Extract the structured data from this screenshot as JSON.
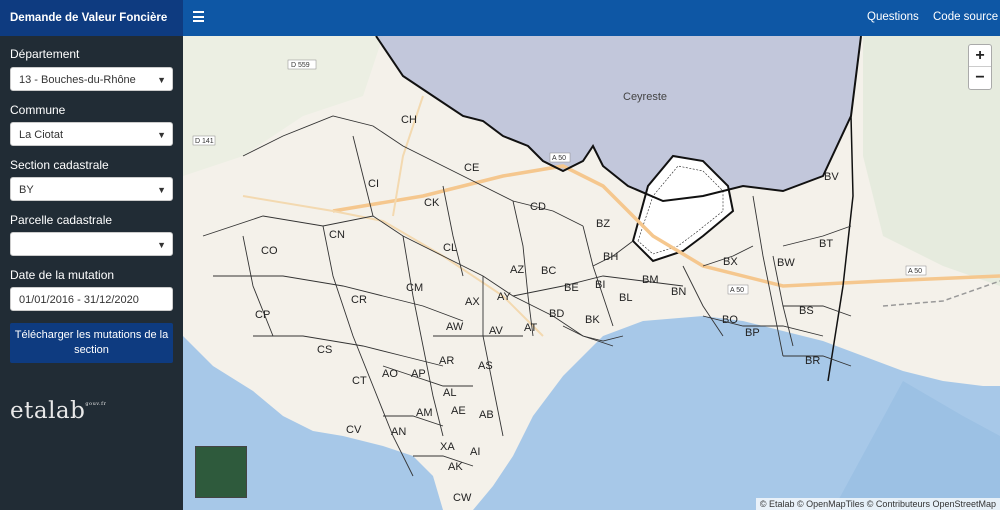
{
  "app": {
    "title": "Demande de Valeur Foncière"
  },
  "nav": {
    "questions": "Questions",
    "source": "Code source"
  },
  "form": {
    "departement_label": "Département",
    "departement_value": "13 - Bouches-du-Rhône",
    "commune_label": "Commune",
    "commune_value": "La Ciotat",
    "section_label": "Section cadastrale",
    "section_value": "BY",
    "parcelle_label": "Parcelle cadastrale",
    "parcelle_value": "",
    "date_label": "Date de la mutation",
    "date_value": "01/01/2016 - 31/12/2020",
    "download_label": "Télécharger les mutations de la section"
  },
  "logo": {
    "text": "etalab",
    "sup": "gouv.fr"
  },
  "map": {
    "place_ceyreste": "Ceyreste",
    "roads": [
      "D 559",
      "D 141",
      "A 50",
      "A 50",
      "A 50"
    ],
    "sections": [
      "CH",
      "CE",
      "CI",
      "CK",
      "CD",
      "BZ",
      "BV",
      "CO",
      "CN",
      "CL",
      "BH",
      "BT",
      "AZ",
      "BC",
      "BX",
      "BW",
      "BM",
      "BE",
      "BI",
      "BN",
      "CP",
      "CR",
      "CM",
      "AX",
      "AY",
      "BL",
      "BS",
      "AW",
      "BD",
      "BK",
      "BO",
      "CS",
      "AV",
      "AT",
      "BP",
      "AR",
      "AS",
      "BR",
      "AO",
      "AP",
      "CT",
      "AL",
      "AM",
      "AE",
      "AB",
      "CV",
      "AN",
      "AI",
      "XA",
      "AK",
      "CW"
    ],
    "attribution": "© Etalab © OpenMapTiles © Contributeurs OpenStreetMap",
    "zoom_in": "+",
    "zoom_out": "−"
  },
  "colors": {
    "brand": "#0e3b80",
    "topbar": "#0e57a5",
    "sidebar": "#212c35",
    "sea": "#a7c8e8",
    "land": "#f4f1ea",
    "highlight": "#b9bfd8"
  }
}
